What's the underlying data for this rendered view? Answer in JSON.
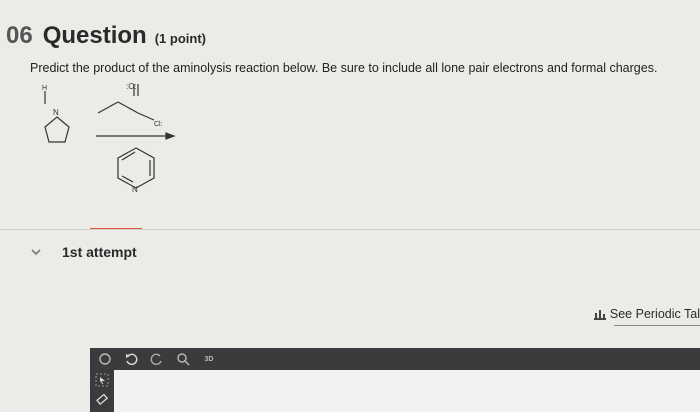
{
  "question": {
    "number": "06",
    "word": "Question",
    "points": "(1 point)",
    "prompt": "Predict the product of the aminolysis reaction below. Be sure to include all lone pair electrons and formal charges."
  },
  "scheme": {
    "amine_h": "H",
    "amine_n": "N",
    "carbonyl_o": ":O:",
    "chloride": "Cl:",
    "pyridine_n": "N"
  },
  "attempt": {
    "label": "1st attempt"
  },
  "periodic": {
    "label": "See Periodic Tal"
  },
  "toolbar": {
    "label_3d": "3D"
  },
  "icons": [
    "chevron-down-icon",
    "bar-chart-icon",
    "undo-icon",
    "redo-icon",
    "zoom-icon",
    "3d-icon",
    "select-icon",
    "eraser-icon"
  ]
}
